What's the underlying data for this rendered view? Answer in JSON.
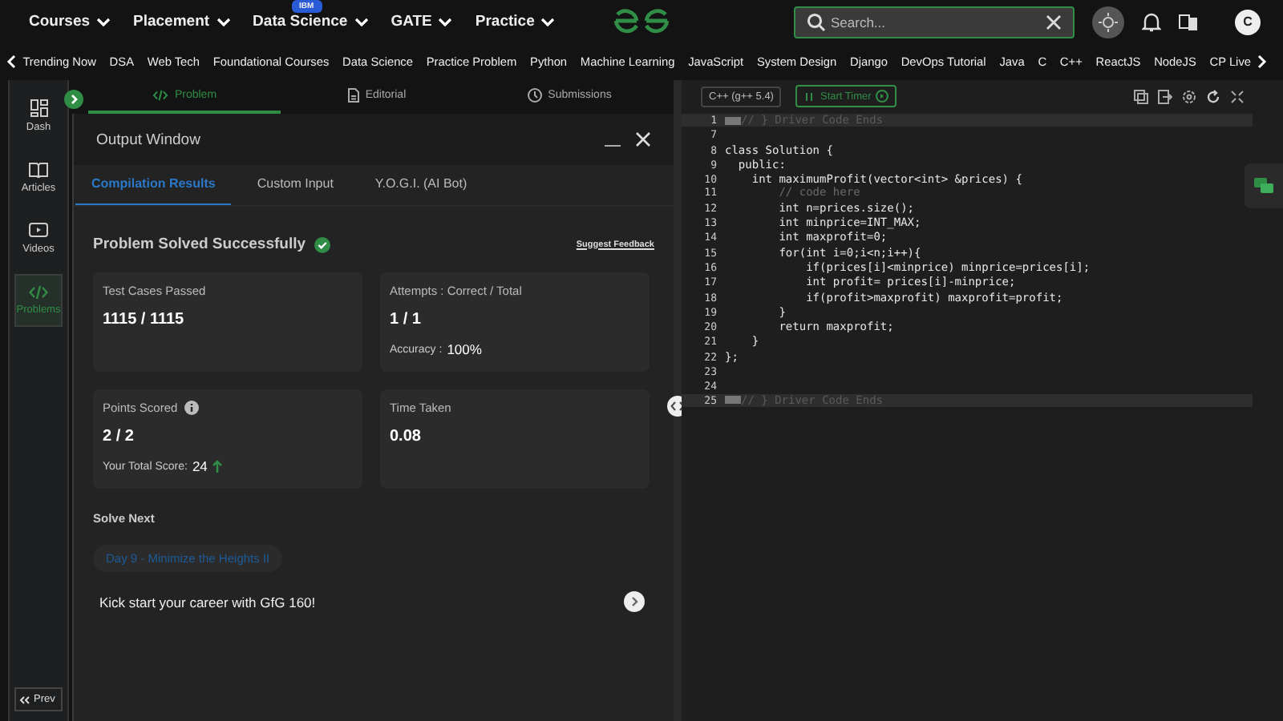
{
  "top_nav": {
    "items": [
      {
        "label": "Courses"
      },
      {
        "label": "Placement"
      },
      {
        "label": "Data Science",
        "badge": "IBM"
      },
      {
        "label": "GATE"
      },
      {
        "label": "Practice"
      }
    ],
    "search": {
      "placeholder": "Search..."
    },
    "avatar": "C"
  },
  "sub_nav": [
    "Trending Now",
    "DSA",
    "Web Tech",
    "Foundational Courses",
    "Data Science",
    "Practice Problem",
    "Python",
    "Machine Learning",
    "JavaScript",
    "System Design",
    "Django",
    "DevOps Tutorial",
    "Java",
    "C",
    "C++",
    "ReactJS",
    "NodeJS",
    "CP Live"
  ],
  "sidebar": {
    "items": [
      {
        "label": "Dash",
        "selected": false
      },
      {
        "label": "Articles",
        "selected": false
      },
      {
        "label": "Videos",
        "selected": false
      },
      {
        "label": "Problems",
        "selected": true
      }
    ],
    "prev": "Prev"
  },
  "problem_tabs": [
    {
      "label": "Problem",
      "selected": true
    },
    {
      "label": "Editorial",
      "selected": false
    },
    {
      "label": "Submissions",
      "selected": false
    }
  ],
  "output_window": {
    "title": "Output Window",
    "tabs": [
      {
        "label": "Compilation Results",
        "selected": true
      },
      {
        "label": "Custom Input",
        "selected": false
      },
      {
        "label": "Y.O.G.I. (AI Bot)",
        "selected": false
      }
    ],
    "status": "Problem Solved Successfully",
    "feedback": "Suggest Feedback",
    "cards": [
      {
        "label": "Test Cases Passed",
        "value": "1115 / 1115",
        "info": false
      },
      {
        "label": "Attempts : Correct / Total",
        "value": "1 / 1",
        "note": "Accuracy :",
        "note_value": "100%",
        "info": false
      },
      {
        "label": "Points Scored",
        "value": "2 / 2",
        "note": "Your Total Score:",
        "note_value": "24",
        "info": true
      },
      {
        "label": "Time Taken",
        "value": "0.08",
        "info": false
      }
    ],
    "solve_next": {
      "heading": "Solve Next",
      "chip": "Day 9 - Minimize the Heights II"
    },
    "promo": "Kick start your career with GfG 160!"
  },
  "editor": {
    "language": "C++ (g++ 5.4)",
    "timer": "Start Timer",
    "lines": [
      {
        "num": "1",
        "kind": "driver",
        "text": "// } Driver Code Ends"
      },
      {
        "num": "7",
        "kind": "code"
      },
      {
        "num": "8",
        "kind": "code",
        "text": "class Solution {"
      },
      {
        "num": "9",
        "kind": "code",
        "text": "  public:"
      },
      {
        "num": "10",
        "kind": "code",
        "text": "    int maximumProfit(vector<int> &prices) {"
      },
      {
        "num": "11",
        "kind": "comment",
        "text": "        // code here"
      },
      {
        "num": "12",
        "kind": "code",
        "text": "        int n=prices.size();"
      },
      {
        "num": "13",
        "kind": "code",
        "text": "        int minprice=INT_MAX;"
      },
      {
        "num": "14",
        "kind": "code",
        "text": "        int maxprofit=0;"
      },
      {
        "num": "15",
        "kind": "code",
        "text": "        for(int i=0;i<n;i++){"
      },
      {
        "num": "16",
        "kind": "code",
        "text": "            if(prices[i]<minprice) minprice=prices[i];"
      },
      {
        "num": "17",
        "kind": "code",
        "text": "            int profit= prices[i]-minprice;"
      },
      {
        "num": "18",
        "kind": "code",
        "text": "            if(profit>maxprofit) maxprofit=profit;"
      },
      {
        "num": "19",
        "kind": "code",
        "text": "        }"
      },
      {
        "num": "20",
        "kind": "code",
        "text": "        return maxprofit;"
      },
      {
        "num": "21",
        "kind": "code",
        "text": "    }"
      },
      {
        "num": "22",
        "kind": "code",
        "text": "};"
      },
      {
        "num": "23",
        "kind": "code"
      },
      {
        "num": "24",
        "kind": "code"
      },
      {
        "num": "25",
        "kind": "driver",
        "text": "// } Driver Code Ends"
      }
    ]
  }
}
